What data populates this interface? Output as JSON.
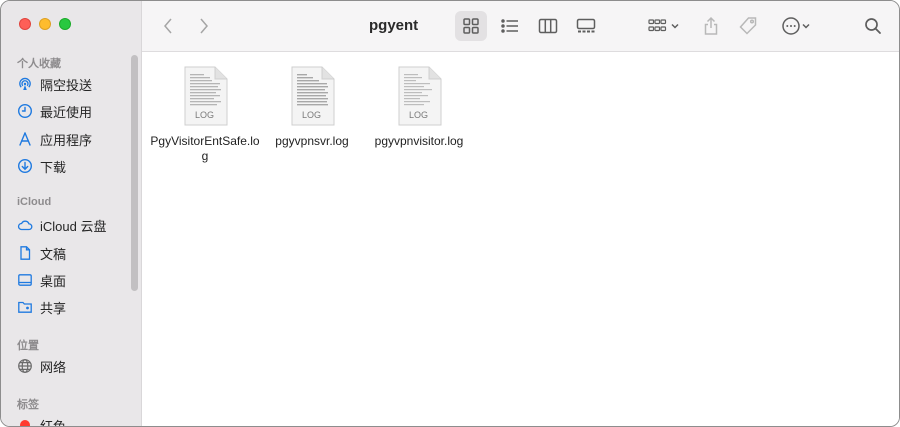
{
  "window": {
    "title": "pgyent"
  },
  "sidebar": {
    "sections": [
      {
        "title": "个人收藏",
        "items": [
          {
            "label": "隔空投送",
            "icon": "airdrop-icon"
          },
          {
            "label": "最近使用",
            "icon": "clock-icon"
          },
          {
            "label": "应用程序",
            "icon": "applications-icon"
          },
          {
            "label": "下载",
            "icon": "download-icon"
          }
        ]
      },
      {
        "title": "iCloud",
        "items": [
          {
            "label": "iCloud 云盘",
            "icon": "cloud-icon"
          },
          {
            "label": "文稿",
            "icon": "document-icon"
          },
          {
            "label": "桌面",
            "icon": "desktop-icon"
          },
          {
            "label": "共享",
            "icon": "shared-folder-icon"
          }
        ]
      },
      {
        "title": "位置",
        "items": [
          {
            "label": "网络",
            "icon": "network-icon"
          }
        ]
      },
      {
        "title": "标签",
        "items": [
          {
            "label": "红色",
            "icon": "red-tag-icon",
            "color": "#ff3b30"
          }
        ]
      }
    ],
    "accent_color": "#1f7ae0"
  },
  "files": [
    {
      "name": "PgyVisitorEntSafe.log",
      "badge": "LOG"
    },
    {
      "name": "pgyvpnsvr.log",
      "badge": "LOG"
    },
    {
      "name": "pgyvpnvisitor.log",
      "badge": "LOG"
    }
  ]
}
